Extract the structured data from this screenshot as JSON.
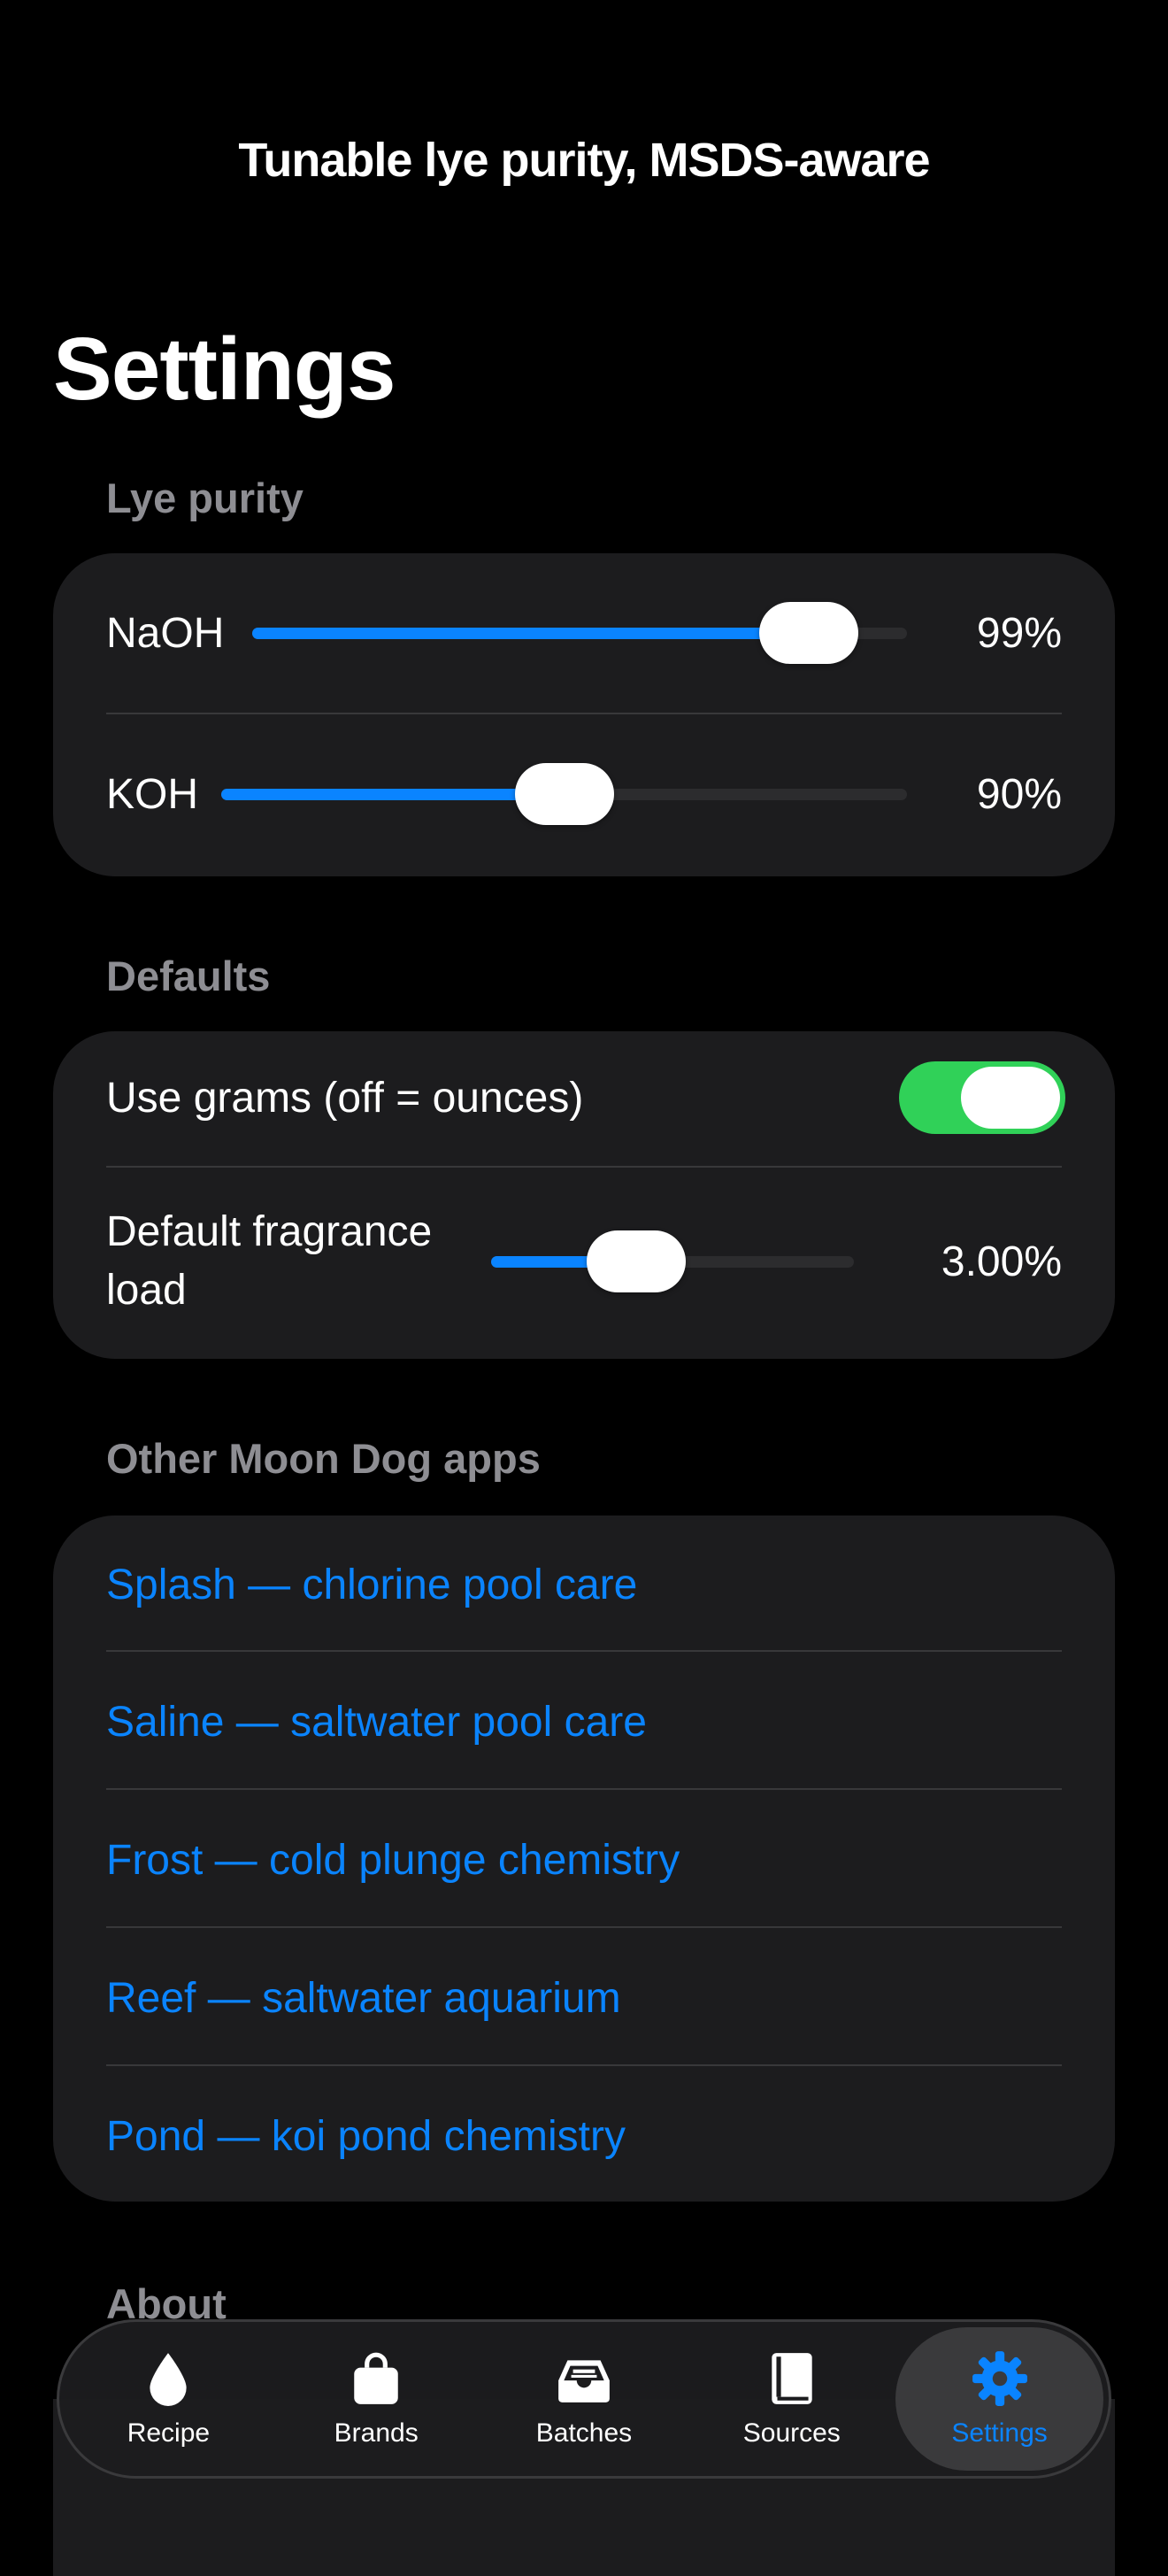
{
  "banner": "Tunable lye purity, MSDS-aware",
  "page_title": "Settings",
  "sections": {
    "lye": {
      "header": "Lye purity",
      "naoh": {
        "label": "NaOH",
        "value": "99%",
        "level": 0.85
      },
      "koh": {
        "label": "KOH",
        "value": "90%",
        "level": 0.5
      }
    },
    "defaults": {
      "header": "Defaults",
      "grams": {
        "label": "Use grams (off = ounces)",
        "on": true
      },
      "fragrance": {
        "label_line1": "Default fragrance",
        "label_line2": "load",
        "value": "3.00%",
        "level": 0.4
      }
    },
    "apps": {
      "header": "Other Moon Dog apps",
      "items": [
        "Splash — chlorine pool care",
        "Saline — saltwater pool care",
        "Frost — cold plunge chemistry",
        "Reef — saltwater aquarium",
        "Pond — koi pond chemistry"
      ]
    },
    "about": {
      "header": "About"
    }
  },
  "tabbar": {
    "tabs": [
      {
        "label": "Recipe",
        "icon": "drop-icon",
        "active": false
      },
      {
        "label": "Brands",
        "icon": "bag-icon",
        "active": false
      },
      {
        "label": "Batches",
        "icon": "tray-icon",
        "active": false
      },
      {
        "label": "Sources",
        "icon": "book-icon",
        "active": false
      },
      {
        "label": "Settings",
        "icon": "gear-icon",
        "active": true
      }
    ]
  },
  "colors": {
    "accent": "#0a84ff",
    "toggle_on": "#30d158",
    "group_bg": "#1c1c1e",
    "secondary_text": "#8e8e93"
  }
}
